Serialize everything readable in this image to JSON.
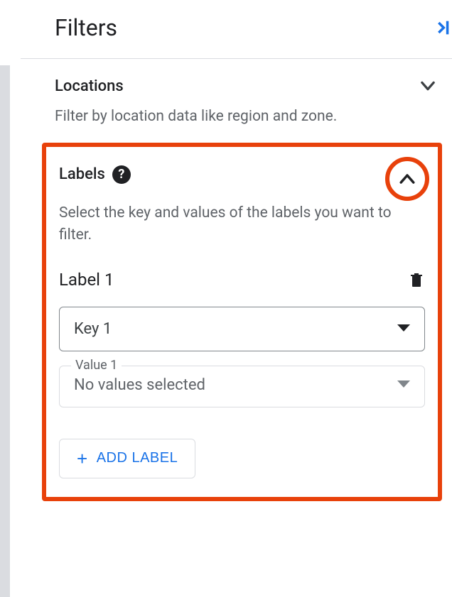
{
  "header": {
    "title": "Filters"
  },
  "locations": {
    "title": "Locations",
    "description": "Filter by location data like region and zone."
  },
  "labels": {
    "title": "Labels",
    "description": "Select the key and values of the labels you want to filter.",
    "label_name": "Label 1",
    "key_select": "Key 1",
    "value_label": "Value 1",
    "value_placeholder": "No values selected",
    "add_button": "ADD LABEL"
  }
}
